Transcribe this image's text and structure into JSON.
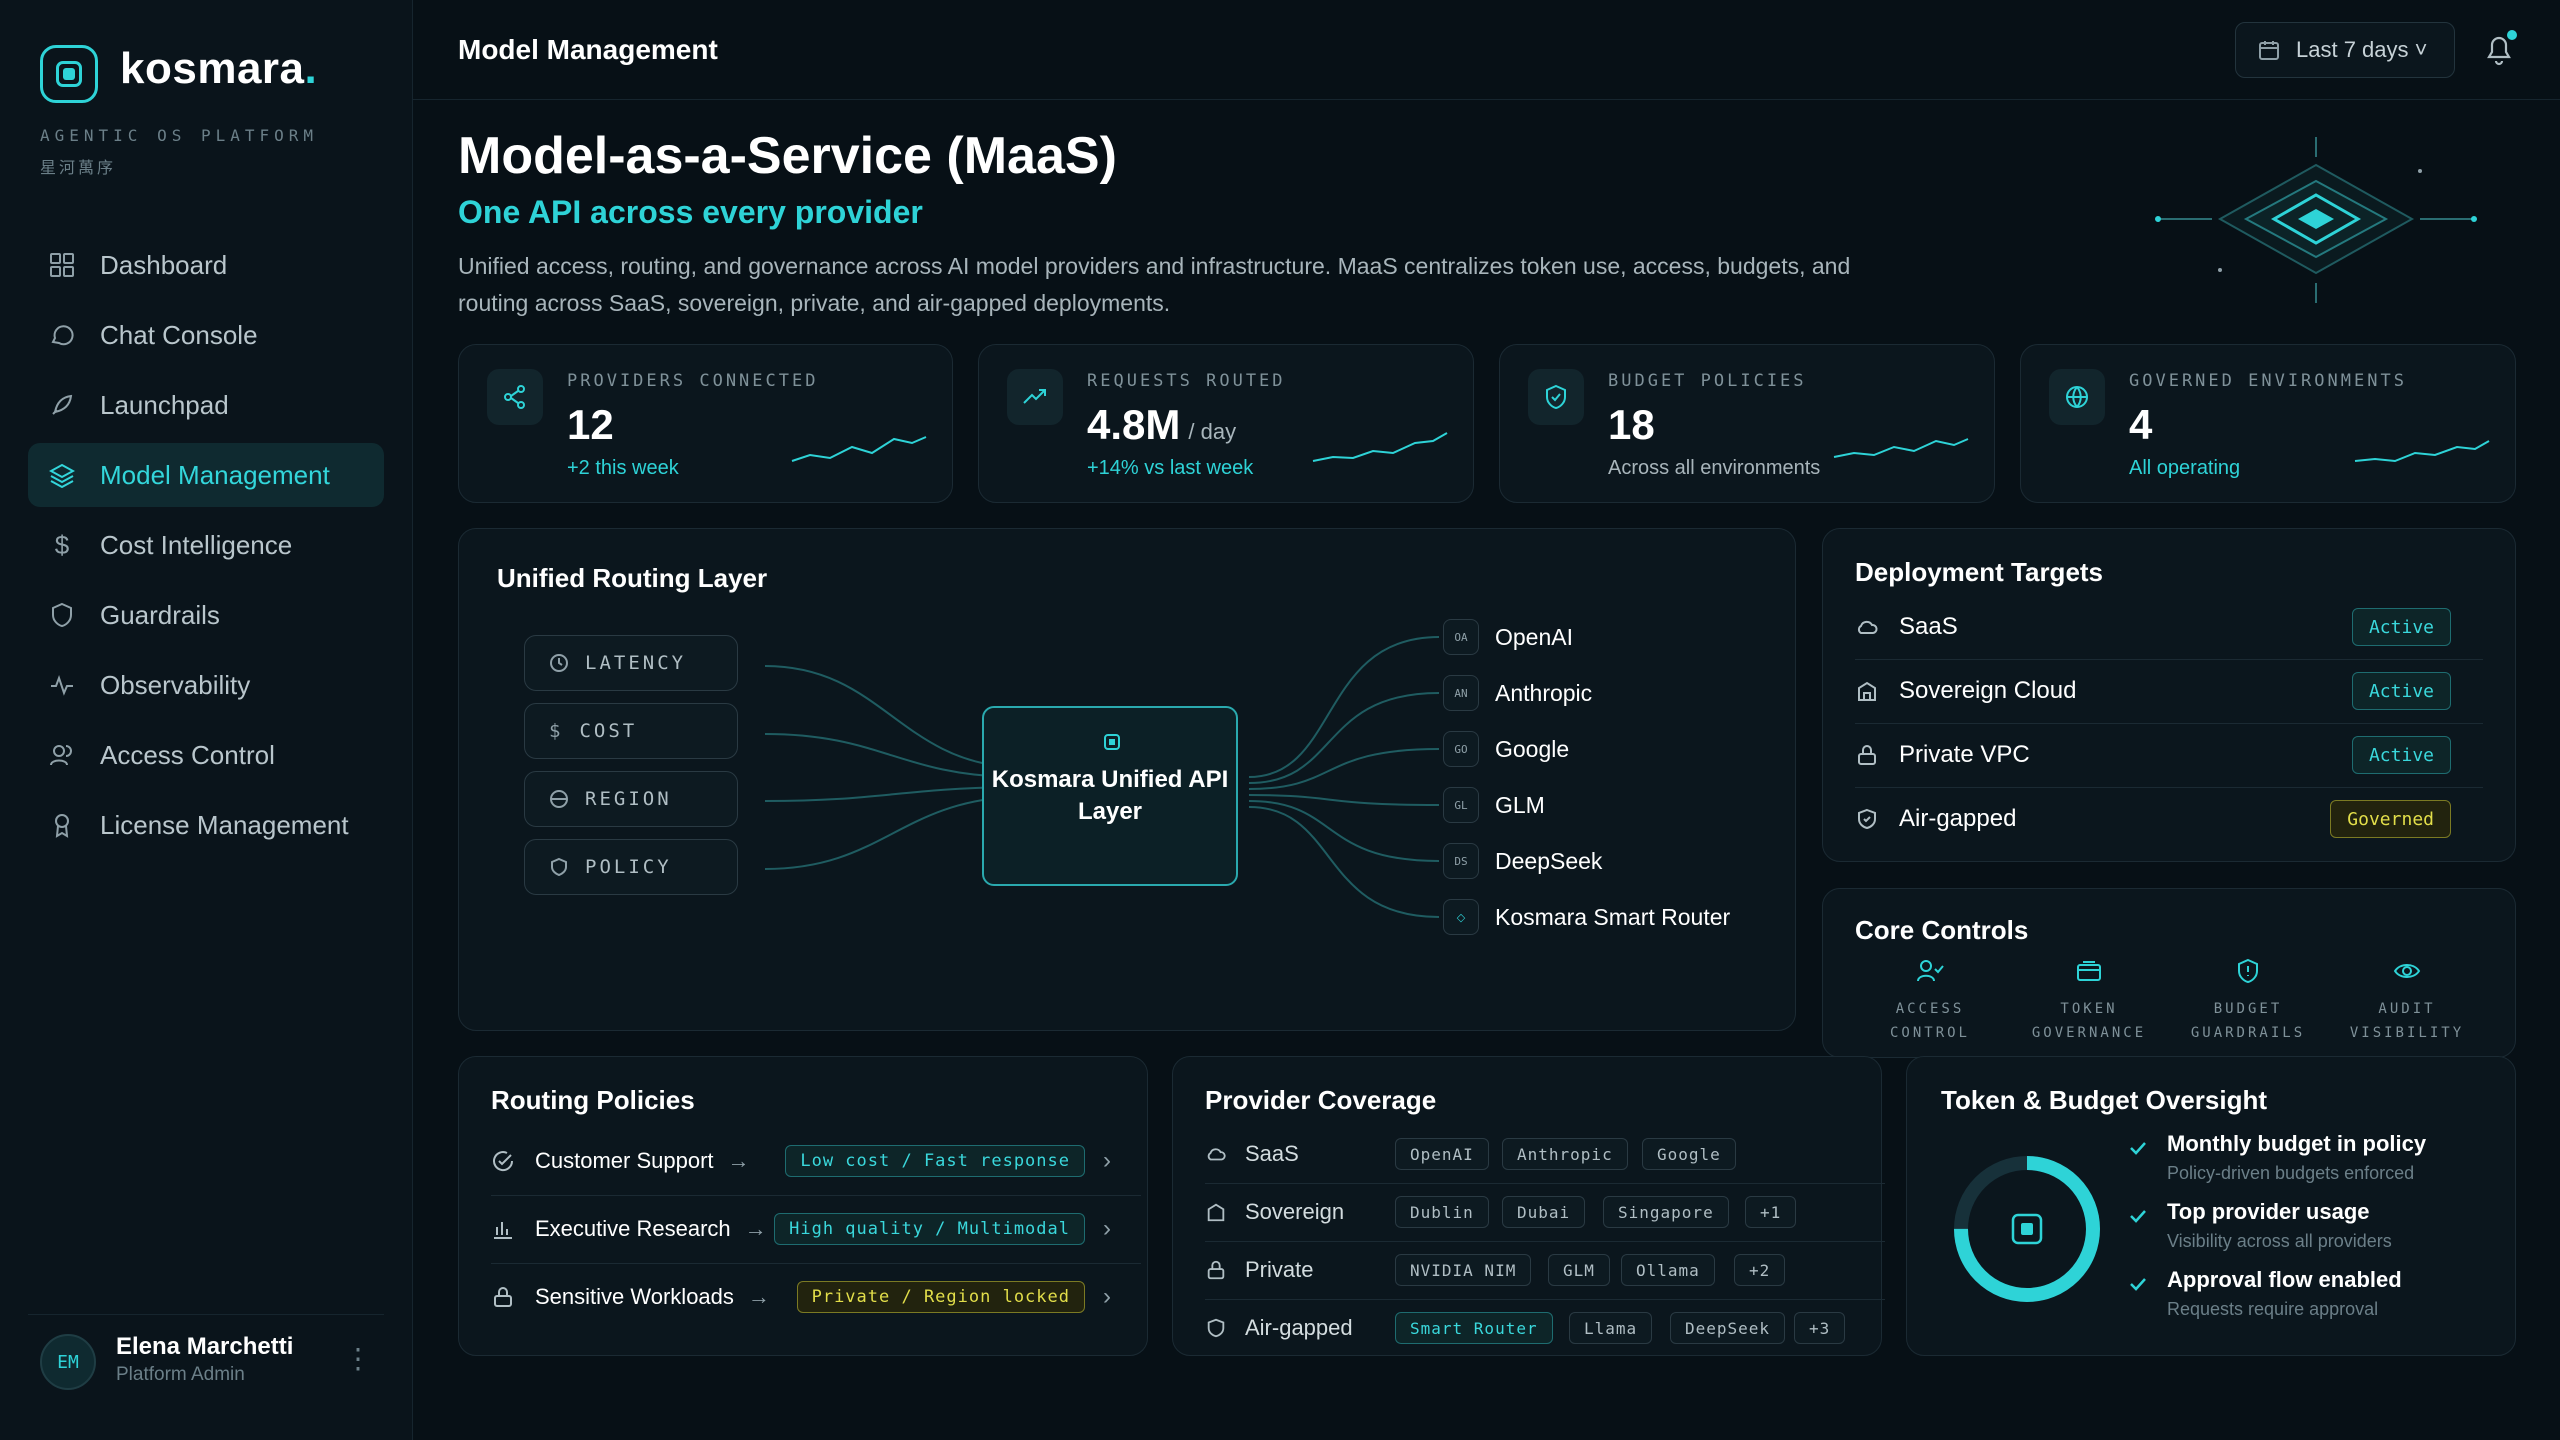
{
  "brand": {
    "name": "kosmara",
    "tagline": "AGENTIC OS PLATFORM",
    "tagline_cn": "星河萬序"
  },
  "nav": [
    {
      "label": "Dashboard",
      "icon": "grid-icon"
    },
    {
      "label": "Chat Console",
      "icon": "chat-icon"
    },
    {
      "label": "Launchpad",
      "icon": "rocket-icon"
    },
    {
      "label": "Model Management",
      "icon": "layers-icon",
      "active": true
    },
    {
      "label": "Cost Intelligence",
      "icon": "dollar-icon"
    },
    {
      "label": "Guardrails",
      "icon": "shield-icon"
    },
    {
      "label": "Observability",
      "icon": "pulse-icon"
    },
    {
      "label": "Access Control",
      "icon": "users-icon"
    },
    {
      "label": "License Management",
      "icon": "badge-icon"
    }
  ],
  "user": {
    "initials": "EM",
    "name": "Elena Marchetti",
    "role": "Platform Admin"
  },
  "topbar": {
    "title": "Model Management",
    "date_range": "Last 7 days ˅"
  },
  "hero": {
    "title": "Model-as-a-Service (MaaS)",
    "subtitle": "One API across every provider",
    "description": "Unified access, routing, and governance across AI model providers and infrastructure. MaaS centralizes token use, access, budgets, and routing across SaaS, sovereign, private, and air-gapped deployments."
  },
  "stats": [
    {
      "label": "PROVIDERS CONNECTED",
      "value": "12",
      "unit": "",
      "sub": "+2 this week",
      "sub_color": "#2ed3d7"
    },
    {
      "label": "REQUESTS ROUTED",
      "value": "4.8M",
      "unit": "/ day",
      "sub": "+14% vs last week",
      "sub_color": "#2ed3d7"
    },
    {
      "label": "BUDGET POLICIES",
      "value": "18",
      "unit": "",
      "sub": "Across all environments",
      "sub_color": "#a8b5bb"
    },
    {
      "label": "GOVERNED ENVIRONMENTS",
      "value": "4",
      "unit": "",
      "sub": "All operating",
      "sub_color": "#2ed3d7"
    }
  ],
  "routing_layer": {
    "title": "Unified Routing Layer",
    "inputs": [
      "LATENCY",
      "COST",
      "REGION",
      "POLICY"
    ],
    "hub": "Kosmara Unified API Layer",
    "providers": [
      {
        "badge": "OA",
        "name": "OpenAI"
      },
      {
        "badge": "AN",
        "name": "Anthropic"
      },
      {
        "badge": "GO",
        "name": "Google"
      },
      {
        "badge": "GL",
        "name": "GLM"
      },
      {
        "badge": "DS",
        "name": "DeepSeek"
      },
      {
        "badge": "◇",
        "name": "Kosmara Smart Router"
      }
    ]
  },
  "deployment": {
    "title": "Deployment Targets",
    "rows": [
      {
        "name": "SaaS",
        "status": "Active"
      },
      {
        "name": "Sovereign Cloud",
        "status": "Active"
      },
      {
        "name": "Private VPC",
        "status": "Active"
      },
      {
        "name": "Air-gapped",
        "status": "Governed"
      }
    ]
  },
  "core_controls": {
    "title": "Core Controls",
    "items": [
      {
        "line1": "ACCESS",
        "line2": "CONTROL"
      },
      {
        "line1": "TOKEN",
        "line2": "GOVERNANCE"
      },
      {
        "line1": "BUDGET",
        "line2": "GUARDRAILS"
      },
      {
        "line1": "AUDIT",
        "line2": "VISIBILITY"
      }
    ]
  },
  "routing_policies": {
    "title": "Routing Policies",
    "rows": [
      {
        "name": "Customer Support",
        "tag": "Low cost / Fast response"
      },
      {
        "name": "Executive Research",
        "tag": "High quality / Multimodal"
      },
      {
        "name": "Sensitive Workloads",
        "tag": "Private / Region locked"
      }
    ]
  },
  "provider_coverage": {
    "title": "Provider Coverage",
    "rows": [
      {
        "name": "SaaS",
        "chips": [
          "OpenAI",
          "Anthropic",
          "Google"
        ]
      },
      {
        "name": "Sovereign",
        "chips": [
          "Dublin",
          "Dubai",
          "Singapore",
          "+1"
        ]
      },
      {
        "name": "Private",
        "chips": [
          "NVIDIA NIM",
          "GLM",
          "Ollama",
          "+2"
        ]
      },
      {
        "name": "Air-gapped",
        "chips": [
          "Smart Router",
          "Llama",
          "DeepSeek",
          "+3"
        ]
      }
    ]
  },
  "token_budget": {
    "title": "Token & Budget Oversight",
    "items": [
      {
        "title": "Monthly budget in policy",
        "sub": "Policy-driven budgets enforced"
      },
      {
        "title": "Top provider usage",
        "sub": "Visibility across all providers"
      },
      {
        "title": "Approval flow enabled",
        "sub": "Requests require approval"
      }
    ]
  },
  "colors": {
    "accent": "#2ed3d7",
    "warning": "#e2de4a",
    "background": "#071016"
  }
}
